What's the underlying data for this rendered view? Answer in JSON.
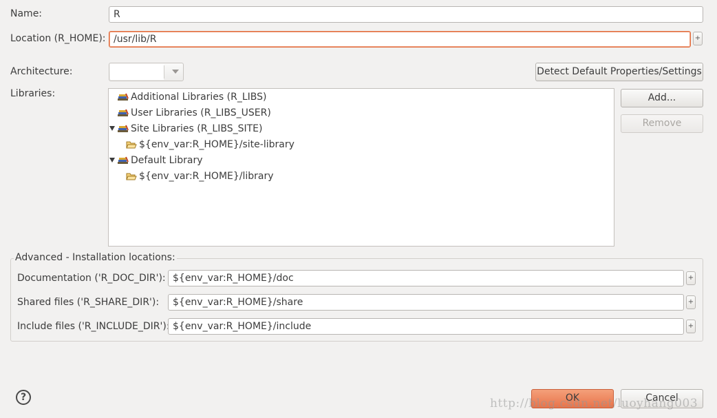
{
  "form": {
    "name_label": "Name:",
    "name_value": "R",
    "location_label": "Location (R_HOME):",
    "location_value": "/usr/lib/R",
    "architecture_label": "Architecture:",
    "architecture_value": "",
    "detect_button": "Detect Default Properties/Settings",
    "libraries_label": "Libraries:"
  },
  "libraries": {
    "items": [
      {
        "label": "Additional Libraries (R_LIBS)",
        "expanded": false
      },
      {
        "label": "User Libraries (R_LIBS_USER)",
        "expanded": false
      },
      {
        "label": "Site Libraries (R_LIBS_SITE)",
        "expanded": true
      },
      {
        "label": "${env_var:R_HOME}/site-library",
        "child": true
      },
      {
        "label": "Default Library",
        "expanded": true
      },
      {
        "label": "${env_var:R_HOME}/library",
        "child": true
      }
    ],
    "add_button": "Add...",
    "remove_button": "Remove"
  },
  "advanced": {
    "title": "Advanced - Installation locations:",
    "doc_label": "Documentation ('R_DOC_DIR'):",
    "doc_value": "${env_var:R_HOME}/doc",
    "share_label": "Shared files ('R_SHARE_DIR'):",
    "share_value": "${env_var:R_HOME}/share",
    "include_label": "Include files ('R_INCLUDE_DIR'):",
    "include_value": "${env_var:R_HOME}/include"
  },
  "footer": {
    "help_glyph": "?",
    "ok_button": "OK",
    "cancel_button": "Cancel",
    "watermark": "http://blog.csdn.net/luoyhang003"
  },
  "plus_glyph": "+",
  "colors": {
    "accent": "#e8734a",
    "window_bg": "#f2f1f0"
  }
}
